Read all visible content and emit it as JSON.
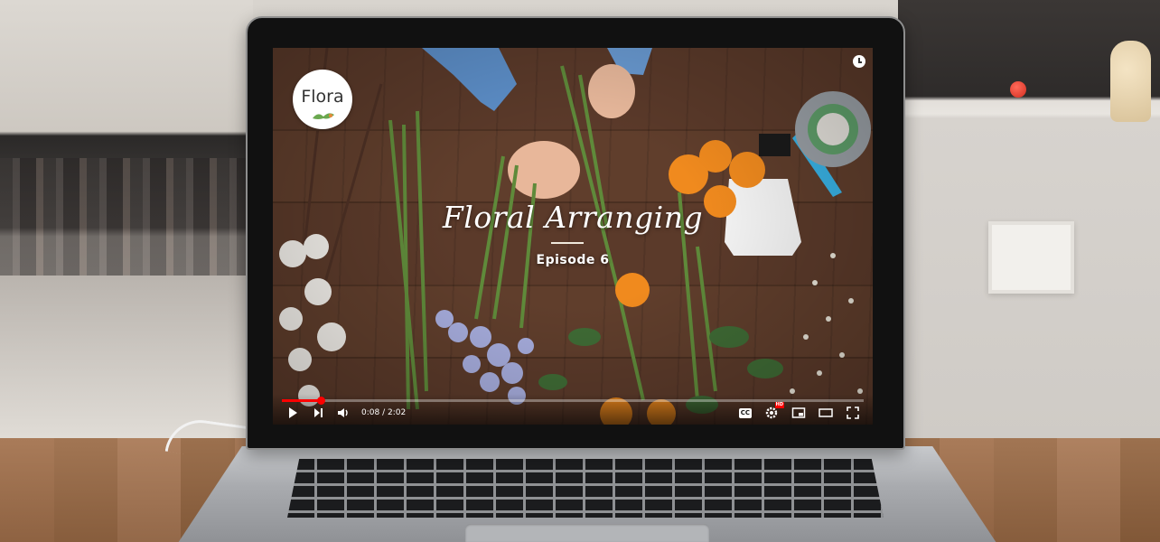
{
  "brand": {
    "logo_text": "Flora"
  },
  "video": {
    "title": "Floral Arranging",
    "subtitle": "Episode 6",
    "time_current": "0:08",
    "time_total": "2:02",
    "time_display": "0:08 / 2:02",
    "progress_fraction": 0.066,
    "quality_badge": "HD",
    "captions_label": "CC"
  },
  "icons": {
    "play": "play-icon",
    "next": "next-icon",
    "volume": "volume-icon",
    "captions": "captions-icon",
    "settings": "gear-icon",
    "miniplayer": "miniplayer-icon",
    "theater": "theater-icon",
    "fullscreen": "fullscreen-icon",
    "watch_later": "clock-icon"
  },
  "colors": {
    "progress": "#ff0000",
    "brand_leaf": "#6aa84f"
  }
}
